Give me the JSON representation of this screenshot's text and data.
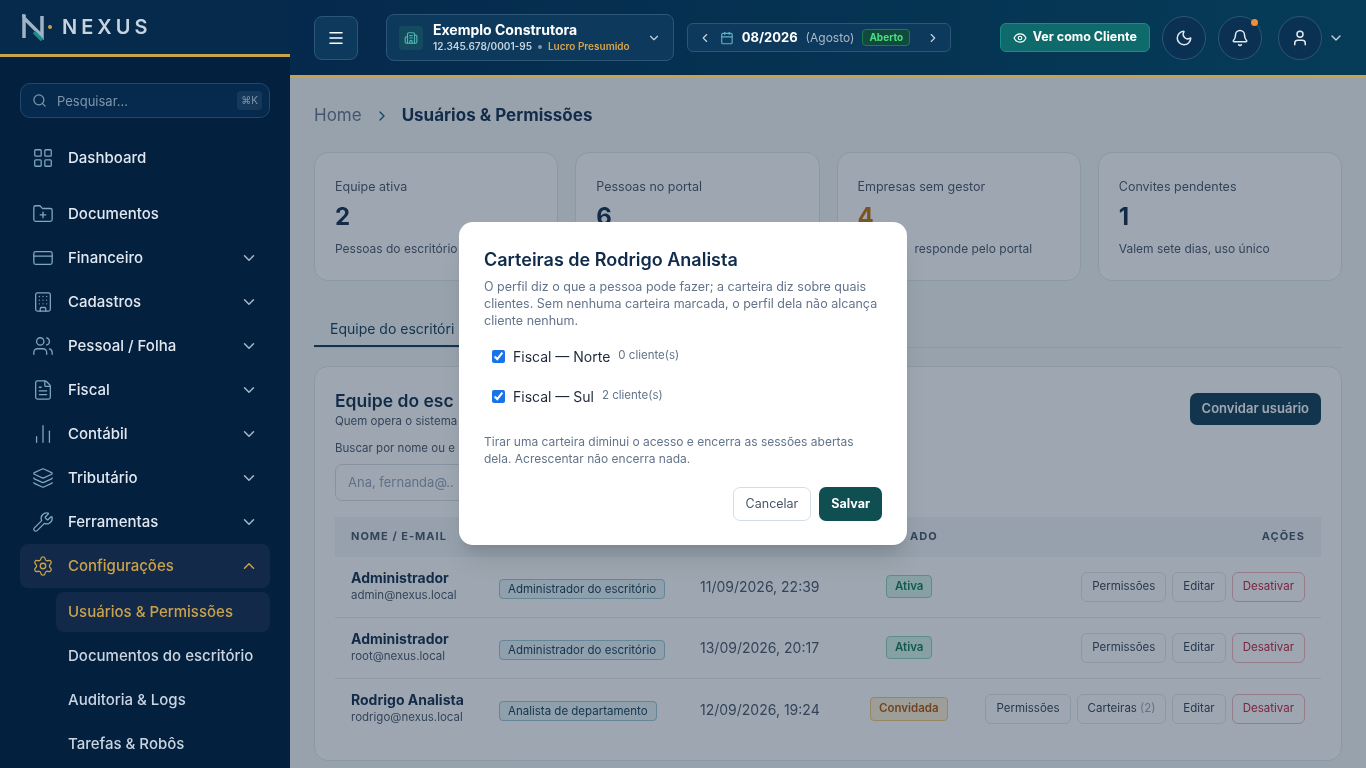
{
  "sidebar": {
    "logo": "NEXUS",
    "search": {
      "placeholder": "Pesquisar...",
      "shortcut": "⌘K"
    },
    "items": [
      {
        "label": "Dashboard",
        "selected": false
      },
      {
        "label": "Documentos",
        "selected": false
      },
      {
        "label": "Financeiro",
        "selected": false,
        "expanded": false
      },
      {
        "label": "Cadastros",
        "selected": false,
        "expanded": false
      },
      {
        "label": "Pessoal / Folha",
        "selected": false,
        "expanded": false
      },
      {
        "label": "Fiscal",
        "selected": false,
        "expanded": false
      },
      {
        "label": "Contábil",
        "selected": false,
        "expanded": false
      },
      {
        "label": "Tributário",
        "selected": false,
        "expanded": false
      },
      {
        "label": "Ferramentas",
        "selected": false,
        "expanded": false
      },
      {
        "label": "Configurações",
        "selected": true,
        "expanded": true,
        "children": [
          {
            "label": "Usuários & Permissões",
            "selected": true
          },
          {
            "label": "Documentos do escritório",
            "selected": false
          },
          {
            "label": "Auditoria & Logs",
            "selected": false
          },
          {
            "label": "Tarefas & Robôs",
            "selected": false
          }
        ]
      }
    ]
  },
  "header": {
    "company": {
      "name": "Exemplo Construtora",
      "cnpj": "12.345.678/0001-95",
      "regime": "Lucro Presumido"
    },
    "period": {
      "value": "08/2026",
      "month": "(Agosto)",
      "status": "Aberto"
    },
    "client_view_button": "Ver como Cliente",
    "notifications_unread": true
  },
  "breadcrumb": [
    "Home",
    "Usuários & Permissões"
  ],
  "stats": [
    {
      "label": "Equipe ativa",
      "value": "2",
      "note": "Pessoas do escritório",
      "kind": "normal"
    },
    {
      "label": "Pessoas no portal",
      "value": "6",
      "kind": "normal"
    },
    {
      "label": "Empresas sem gestor",
      "value": "4",
      "note": "responde pelo portal",
      "kind": "warning"
    },
    {
      "label": "Convites pendentes",
      "value": "1",
      "note": "Valem sete dias, uso único",
      "kind": "normal"
    }
  ],
  "tabs": [
    {
      "label": "Equipe do escritóri",
      "selected": true
    }
  ],
  "team": {
    "title": "Equipe do esc",
    "subtitle": "Quem opera o sistema",
    "invite_button": "Convidar usuário",
    "search_label": "Buscar por nome ou e",
    "search_placeholder": "Ana, fernanda@..",
    "columns": [
      "NOME / E-MAIL",
      "ADO",
      "AÇÕES"
    ],
    "rows": [
      {
        "name": "Administrador",
        "email": "admin@nexus.local",
        "role": "Administrador do escritório",
        "date": "11/09/2026, 22:39",
        "status": {
          "label": "Ativa",
          "kind": "active"
        },
        "actions": [
          {
            "label": "Permissões",
            "kind": "neutral"
          },
          {
            "label": "Editar",
            "kind": "neutral"
          },
          {
            "label": "Desativar",
            "kind": "danger"
          }
        ]
      },
      {
        "name": "Administrador",
        "email": "root@nexus.local",
        "role": "Administrador do escritório",
        "date": "13/09/2026, 20:17",
        "status": {
          "label": "Ativa",
          "kind": "active"
        },
        "actions": [
          {
            "label": "Permissões",
            "kind": "neutral"
          },
          {
            "label": "Editar",
            "kind": "neutral"
          },
          {
            "label": "Desativar",
            "kind": "danger"
          }
        ]
      },
      {
        "name": "Rodrigo Analista",
        "email": "rodrigo@nexus.local",
        "role": "Analista de departamento",
        "date": "12/09/2026, 19:24",
        "status": {
          "label": "Convidada",
          "kind": "invited"
        },
        "actions": [
          {
            "label": "Permissões",
            "kind": "neutral"
          },
          {
            "label": "Carteiras",
            "count": "(2)",
            "kind": "neutral"
          },
          {
            "label": "Editar",
            "kind": "neutral"
          },
          {
            "label": "Desativar",
            "kind": "danger"
          }
        ]
      }
    ]
  },
  "modal": {
    "title": "Carteiras de Rodrigo Analista",
    "description": "O perfil diz o que a pessoa pode fazer; a carteira diz sobre quais clientes. Sem nenhuma carteira marcada, o perfil dela não alcança cliente nenhum.",
    "options": [
      {
        "label": "Fiscal — Norte",
        "count": "0 cliente(s)",
        "checked": true
      },
      {
        "label": "Fiscal — Sul",
        "count": "2 cliente(s)",
        "checked": true
      }
    ],
    "note": "Tirar uma carteira diminui o acesso e encerra as sessões abertas dela. Acrescentar não encerra nada.",
    "buttons": [
      {
        "label": "Cancelar",
        "kind": "secondary"
      },
      {
        "label": "Salvar",
        "kind": "primary"
      }
    ]
  }
}
